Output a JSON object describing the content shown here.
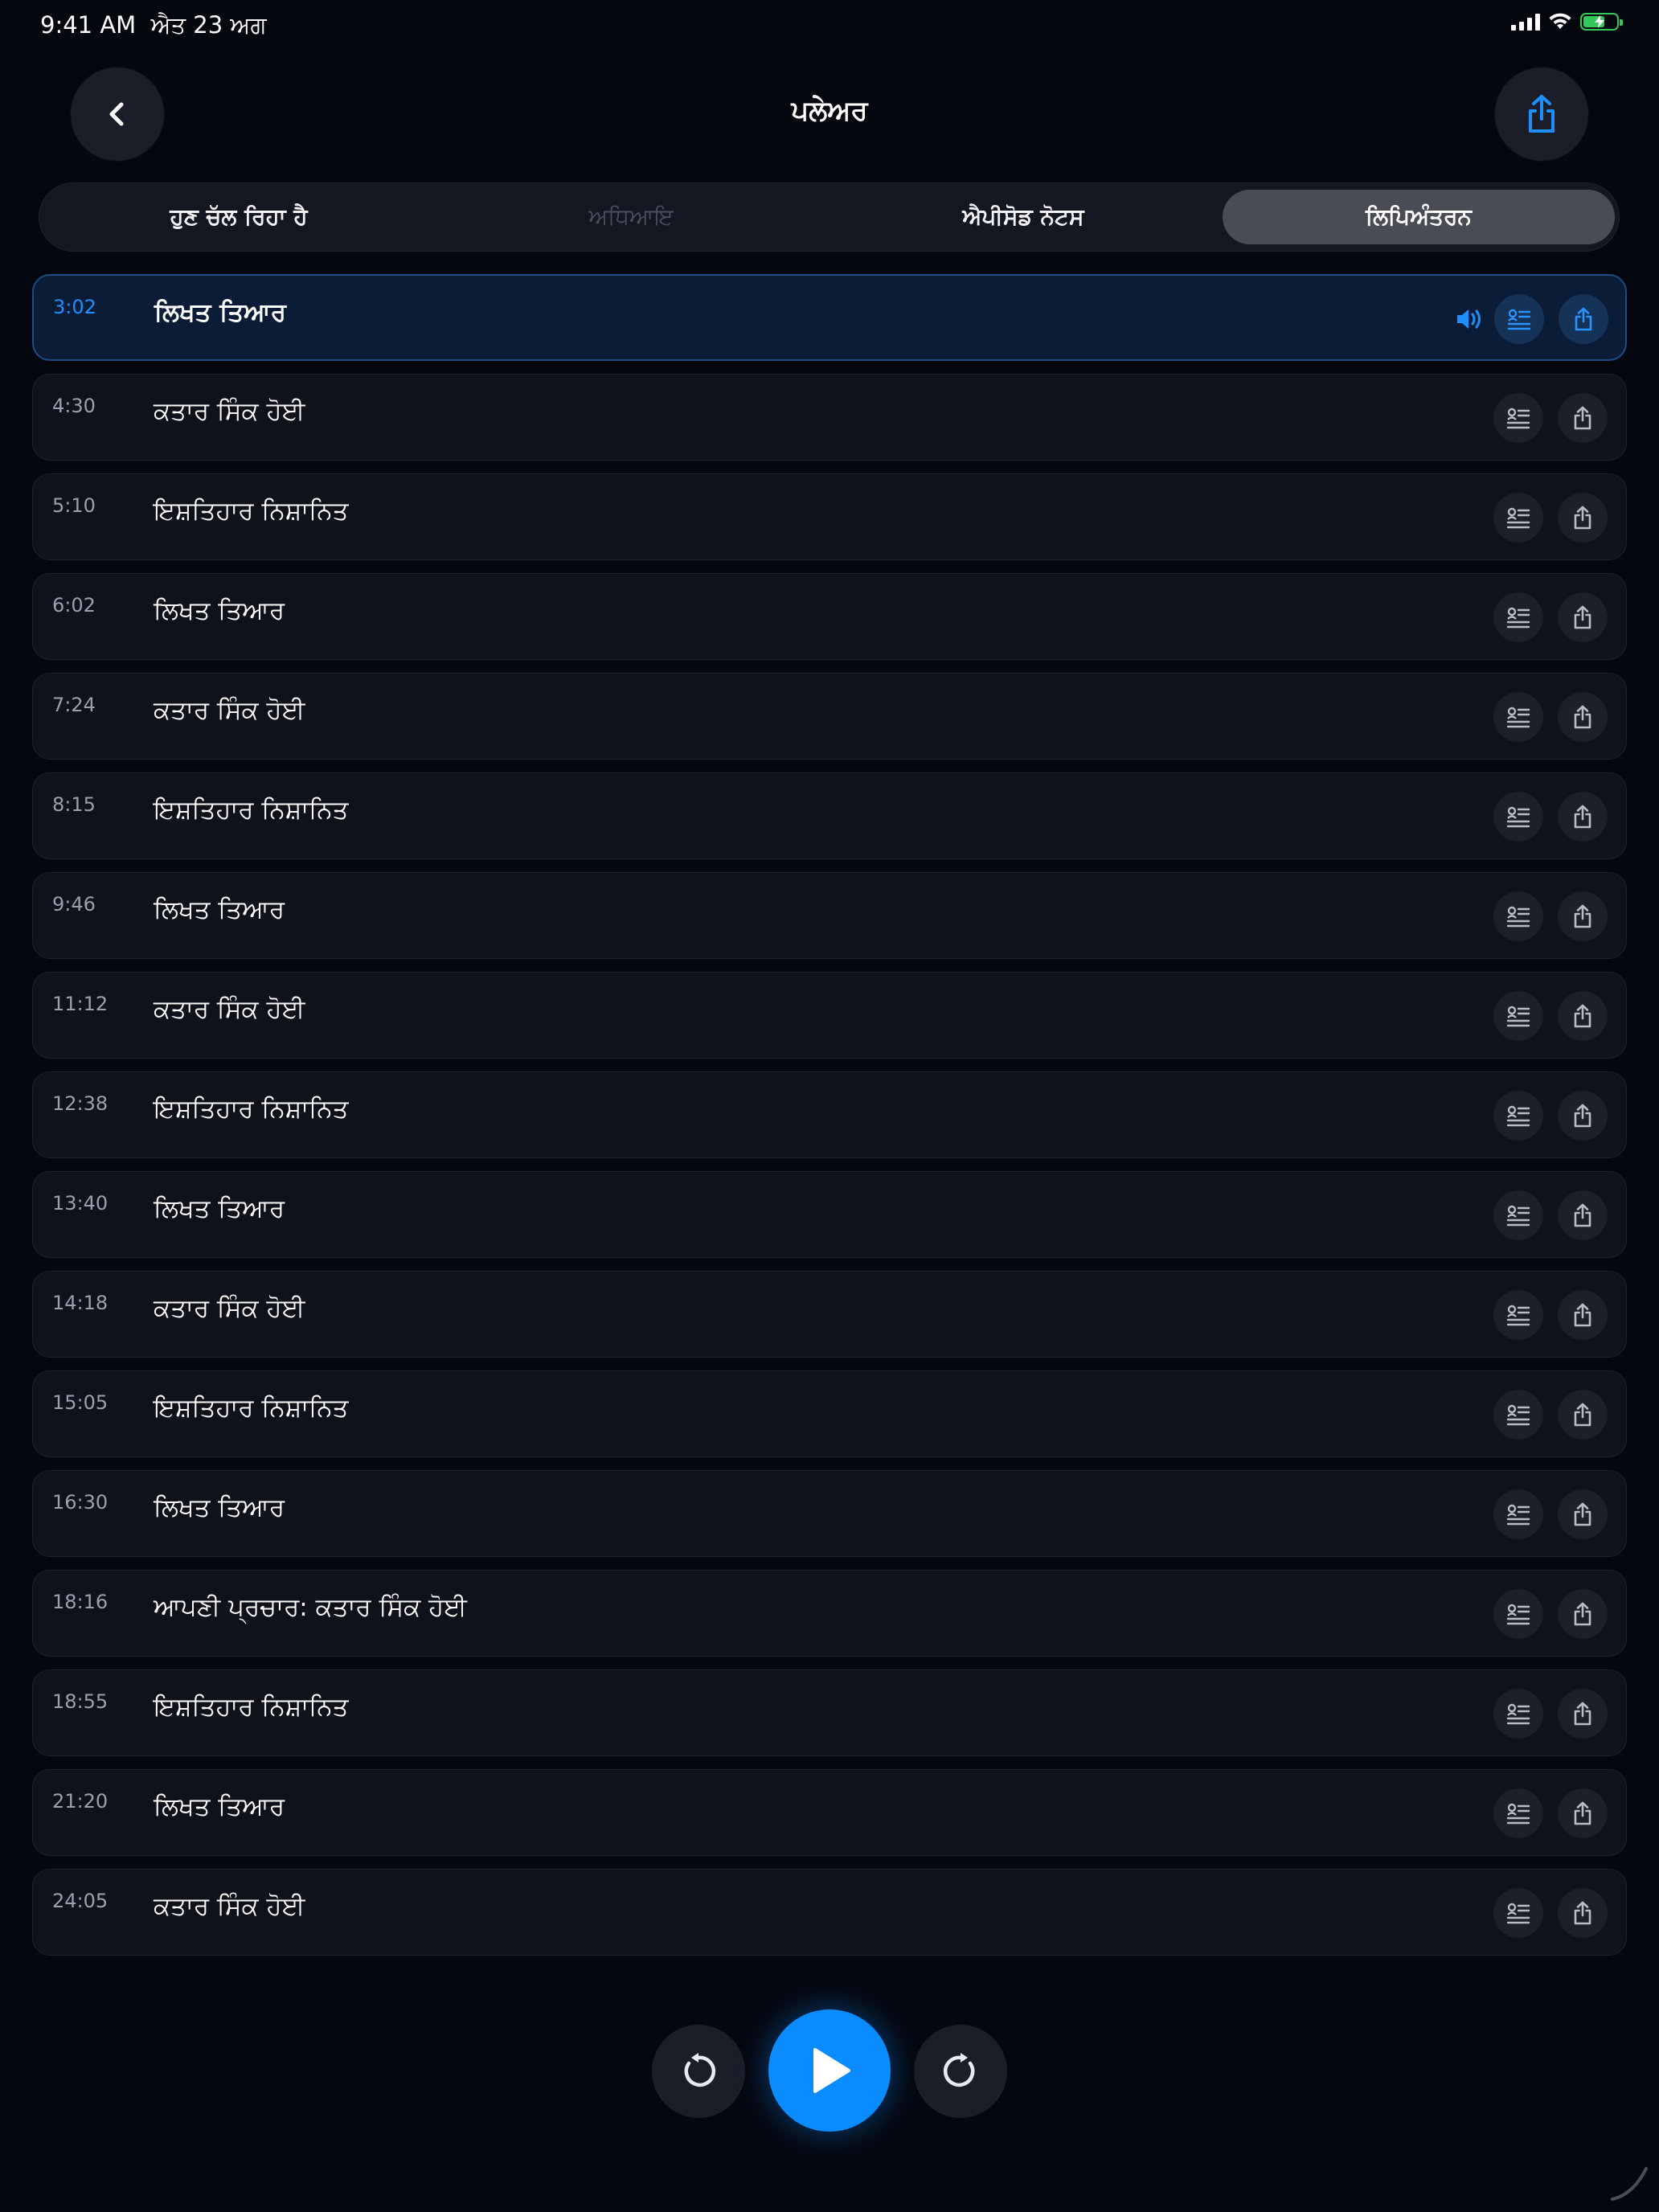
{
  "status_bar": {
    "time": "9:41 AM",
    "date": "ਐਤ 23 ਅਗ",
    "icons": [
      "cellular-signal-icon",
      "wifi-icon",
      "battery-charging-icon"
    ],
    "battery_color": "#34c759"
  },
  "header": {
    "title": "ਪਲੇਅਰ",
    "back_icon": "chevron-left-icon",
    "share_icon": "share-icon"
  },
  "tabs": [
    {
      "label": "ਹੁਣ ਚੱਲ ਰਿਹਾ ਹੈ",
      "state": "normal"
    },
    {
      "label": "ਅਧਿਆਇ",
      "state": "disabled"
    },
    {
      "label": "ਐਪੀਸੋਡ ਨੋਟਸ",
      "state": "normal"
    },
    {
      "label": "ਲਿਪਿਅੰਤਰਨ",
      "state": "selected"
    }
  ],
  "transcript": [
    {
      "time": "3:02",
      "text": "ਲਿਖਤ ਤਿਆਰ",
      "active": true
    },
    {
      "time": "4:30",
      "text": "ਕਤਾਰ ਸਿੰਕ ਹੋਈ"
    },
    {
      "time": "5:10",
      "text": "ਇਸ਼ਤਿਹਾਰ ਨਿਸ਼ਾਨਿਤ"
    },
    {
      "time": "6:02",
      "text": "ਲਿਖਤ ਤਿਆਰ"
    },
    {
      "time": "7:24",
      "text": "ਕਤਾਰ ਸਿੰਕ ਹੋਈ"
    },
    {
      "time": "8:15",
      "text": "ਇਸ਼ਤਿਹਾਰ ਨਿਸ਼ਾਨਿਤ"
    },
    {
      "time": "9:46",
      "text": "ਲਿਖਤ ਤਿਆਰ"
    },
    {
      "time": "11:12",
      "text": "ਕਤਾਰ ਸਿੰਕ ਹੋਈ"
    },
    {
      "time": "12:38",
      "text": "ਇਸ਼ਤਿਹਾਰ ਨਿਸ਼ਾਨਿਤ"
    },
    {
      "time": "13:40",
      "text": "ਲਿਖਤ ਤਿਆਰ"
    },
    {
      "time": "14:18",
      "text": "ਕਤਾਰ ਸਿੰਕ ਹੋਈ"
    },
    {
      "time": "15:05",
      "text": "ਇਸ਼ਤਿਹਾਰ ਨਿਸ਼ਾਨਿਤ"
    },
    {
      "time": "16:30",
      "text": "ਲਿਖਤ ਤਿਆਰ"
    },
    {
      "time": "18:16",
      "text": "ਆਪਣੀ ਪ੍ਰਚਾਰ: ਕਤਾਰ ਸਿੰਕ ਹੋਈ"
    },
    {
      "time": "18:55",
      "text": "ਇਸ਼ਤਿਹਾਰ ਨਿਸ਼ਾਨਿਤ"
    },
    {
      "time": "21:20",
      "text": "ਲਿਖਤ ਤਿਆਰ"
    },
    {
      "time": "24:05",
      "text": "ਕਤਾਰ ਸਿੰਕ ਹੋਈ"
    }
  ],
  "row_icons": {
    "speaker": "speaker-icon",
    "lyrics": "transcript-lines-icon",
    "share": "share-icon"
  },
  "controls": {
    "skip_back_icon": "skip-back-icon",
    "play_icon": "play-icon",
    "skip_forward_icon": "skip-forward-icon"
  },
  "colors": {
    "accent": "#0a8cff",
    "active_row_bg": "#0b1d36",
    "background": "#05070f"
  }
}
